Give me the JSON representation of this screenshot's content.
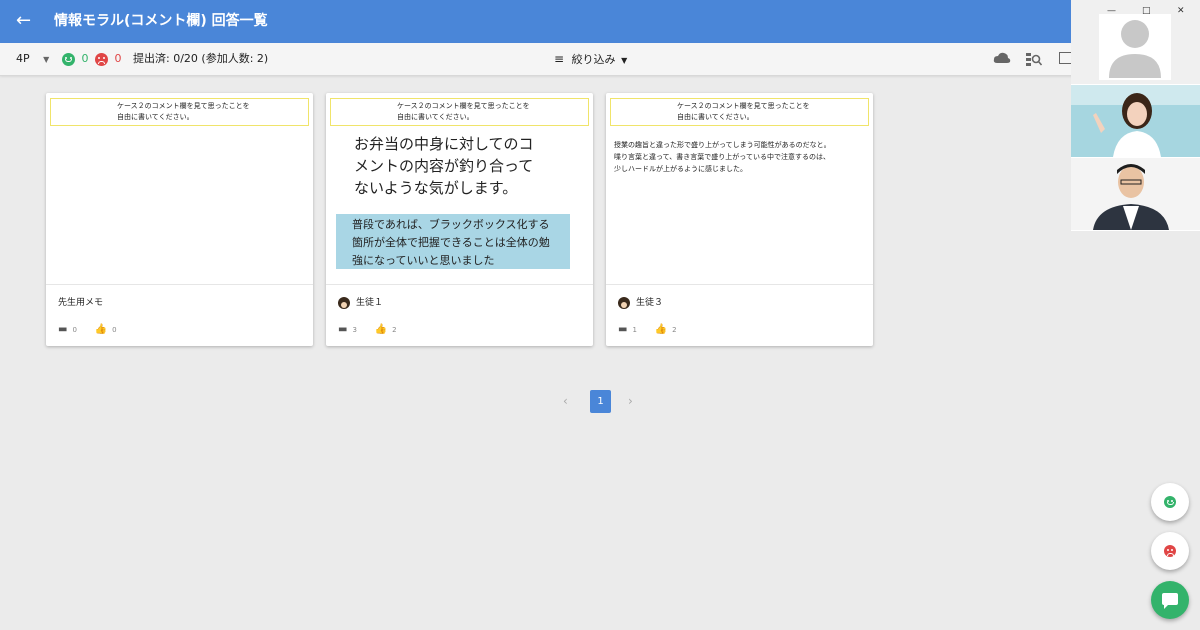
{
  "header": {
    "title": "情報モラル(コメント欄) 回答一覧",
    "back_icon": "arrow-back-icon",
    "color": "#4a86d8"
  },
  "toolbar": {
    "class_select": "4P",
    "good_count": "0",
    "bad_count": "0",
    "submitted": "提出済: 0/20 (参加人数: 2)",
    "filter_label": "絞り込み",
    "good_color": "#33b36b",
    "bad_color": "#e04646"
  },
  "cards": [
    {
      "prompt_line1": "ケース２のコメント欄を見て思ったことを",
      "prompt_line2": "自由に書いてください。",
      "author": "先生用メモ",
      "comments": "0",
      "likes": "0"
    },
    {
      "prompt_line1": "ケース２のコメント欄を見て思ったことを",
      "prompt_line2": "自由に書いてください。",
      "handwritten": [
        "お弁当の中身に対してのコ",
        "メントの内容が釣り合って",
        "ないような気がします。"
      ],
      "note": [
        "普段であれば、ブラックボックス化する",
        "箇所が全体で把握できることは全体の勉",
        "強になっていいと思いました"
      ],
      "author": "生徒１",
      "comments": "3",
      "likes": "2"
    },
    {
      "prompt_line1": "ケース２のコメント欄を見て思ったことを",
      "prompt_line2": "自由に書いてください。",
      "text": [
        "授業の趣旨と違った形で盛り上がってしまう可能性があるのだなと。",
        "喋り言葉と違って、書き言葉で盛り上がっている中で注意するのは、",
        "少しハードルが上がるように感じました。"
      ],
      "author": "生徒３",
      "comments": "1",
      "likes": "2"
    }
  ],
  "pagination": {
    "current_page": "1",
    "prev": "‹",
    "next": "›"
  }
}
